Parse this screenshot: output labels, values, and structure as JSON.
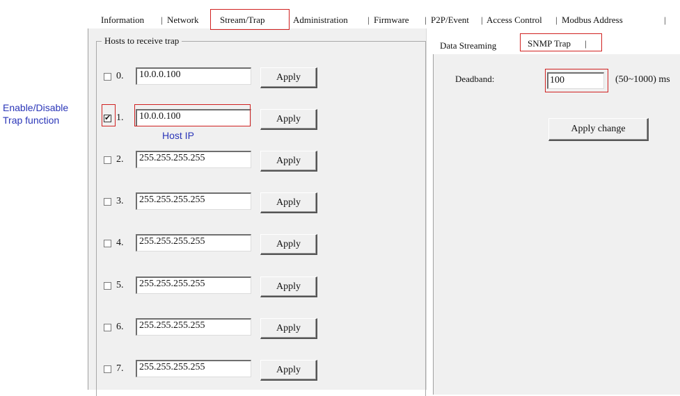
{
  "main_tabs": [
    {
      "label": "Information"
    },
    {
      "label": "Network"
    },
    {
      "label": "Stream/Trap"
    },
    {
      "label": "Administration"
    },
    {
      "label": "Firmware"
    },
    {
      "label": "P2P/Event"
    },
    {
      "label": "Access Control"
    },
    {
      "label": "Modbus Address"
    }
  ],
  "hosts_group": {
    "title": "Hosts to receive trap",
    "apply_label": "Apply",
    "rows": [
      {
        "num": "0.",
        "ip": "10.0.0.100",
        "checked": false
      },
      {
        "num": "1.",
        "ip": "10.0.0.100",
        "checked": true
      },
      {
        "num": "2.",
        "ip": "255.255.255.255",
        "checked": false
      },
      {
        "num": "3.",
        "ip": "255.255.255.255",
        "checked": false
      },
      {
        "num": "4.",
        "ip": "255.255.255.255",
        "checked": false
      },
      {
        "num": "5.",
        "ip": "255.255.255.255",
        "checked": false
      },
      {
        "num": "6.",
        "ip": "255.255.255.255",
        "checked": false
      },
      {
        "num": "7.",
        "ip": "255.255.255.255",
        "checked": false
      }
    ]
  },
  "sub_tabs": [
    {
      "label": "Data Streaming"
    },
    {
      "label": "SNMP Trap"
    }
  ],
  "snmp_trap": {
    "deadband_label": "Deadband:",
    "deadband_value": "100",
    "range_text": "(50~1000) ms",
    "apply_change_label": "Apply change"
  },
  "annotations": {
    "enable_disable_line1": "Enable/Disable",
    "enable_disable_line2": "Trap function",
    "host_ip": "Host IP"
  },
  "colors": {
    "annotation_blue": "#2a35b8",
    "highlight_red": "#d0201f",
    "panel_bg": "#f0f0f0"
  }
}
